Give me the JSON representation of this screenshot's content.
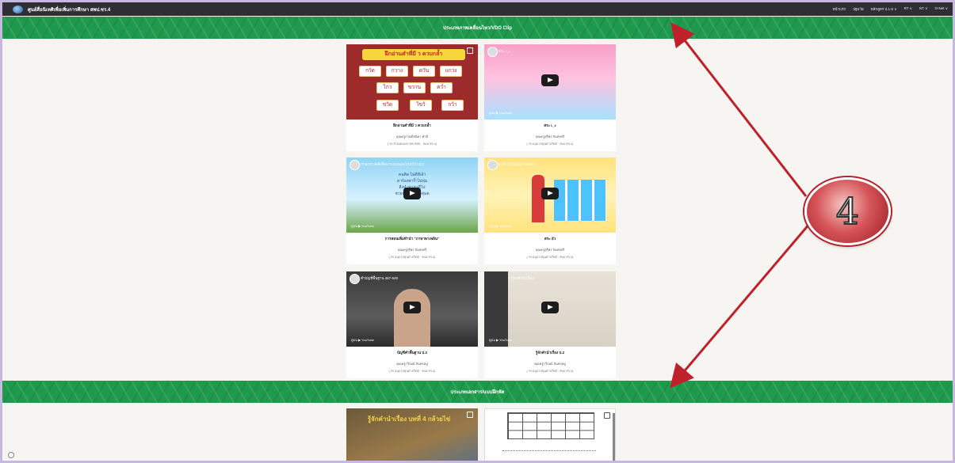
{
  "site": {
    "title": "ศูนย์สื่อนิเทศิเพื่อเพิ่มการศึกษา สพป.ชร.4",
    "nav": [
      "หน้าแรก",
      "ปฐมวัย",
      "หลักสูตร ป.1-6 ∨",
      "RT ∨",
      "NT ∨",
      "O-Net ∨"
    ]
  },
  "sections": [
    {
      "label": "ประเภทภาพเคลื่อนไหว/VDO Clip"
    },
    {
      "label": "ประเภทเอกสาร/แบบฝึกหัด"
    }
  ],
  "videos": [
    {
      "caption": "ฝึกอ่านคำที่มี ว ควบกล้ำ",
      "author": "คุณครูกานต์ชนิดา คำดี",
      "school": "( รร.บ้านหนองกาศกายจัง · สพป.ชร.4)",
      "thumb_title": "ฝึกอ่านคำที่มี ว ควบกล้ำ",
      "words": [
        "กวัด",
        "กวาง",
        "ควัน",
        "แกว่ง",
        "ไกว",
        "ขวาน",
        "คว่ำ",
        "ขวิด",
        "ไขว้",
        "กว้า"
      ]
    },
    {
      "caption": "สระ เ_ะ",
      "author": "คุณครูสุรีพร จันทรศรี",
      "school": "( รร.อนุบาลขุนตาลวิทย์ · สพป.ชร.4)",
      "thumb_title": "สระ เ_ะ"
    },
    {
      "caption": "การสอนเพิ่มทำนำ \"ภาษาพาเพลิน\"",
      "author": "คุณครูสุรีพร จันทรศรี",
      "school": "( รร.อนุบาลขุนตาลวิทย์ · สพป.ชร.4)",
      "thumb_title": "ภาษาทางพลิเพื่อน ระบบเพลงโกลวโห ป.2",
      "thumb_text": "คนคิด ไม่ดีที่เจ้า\nคาร้องพาร้ำไม่ทุ่ม\nสิ่งนำพาชาดีไป\nช่วยปลุกใจหมื่อทุ่มต"
    },
    {
      "caption": "สระ อัว",
      "author": "คุณครูสุรีพร จันทรศรี",
      "school": "( รร.อนุบาลขุนตาลวิทย์ · สพป.ชร.4)",
      "thumb_title": "ผลที่ 8 ไม่ปัญน์ภาษาสระ"
    },
    {
      "caption": "บัญชีคำพื้นฐาน ป.2",
      "author": "คุณครูกวีณณ์ จันทรหมู่",
      "school": "( รร.อนุบาลขุนตาลวิทย์ · สพป.ชร.4)",
      "thumb_title": "คำบัญชีพื้นฐาน 487-520"
    },
    {
      "caption": "รู้จักคำนำเรื่อง ป.2",
      "author": "คุณครูกวีณณ์ จันทรหมู่",
      "school": "( รร.อนุบาลขุนตาลวิทย์ · สพป.ชร.4)",
      "thumb_title": "บทที่ 10 รู้จักคำนำเรื่อง"
    }
  ],
  "documents": [
    {
      "thumb_title": "รู้จักคำนำเรื่อง บทที่ 4 กล้วยไข่"
    },
    {
      "thumb_title": ""
    }
  ],
  "youtube_label": "ดูบน ▶ YouTube",
  "annotation": {
    "number": "4",
    "color": "#c0202a"
  },
  "colors": {
    "banner": "#1f9a4d",
    "topbar": "#2f2f33",
    "page_bg": "#f7f5f2"
  }
}
